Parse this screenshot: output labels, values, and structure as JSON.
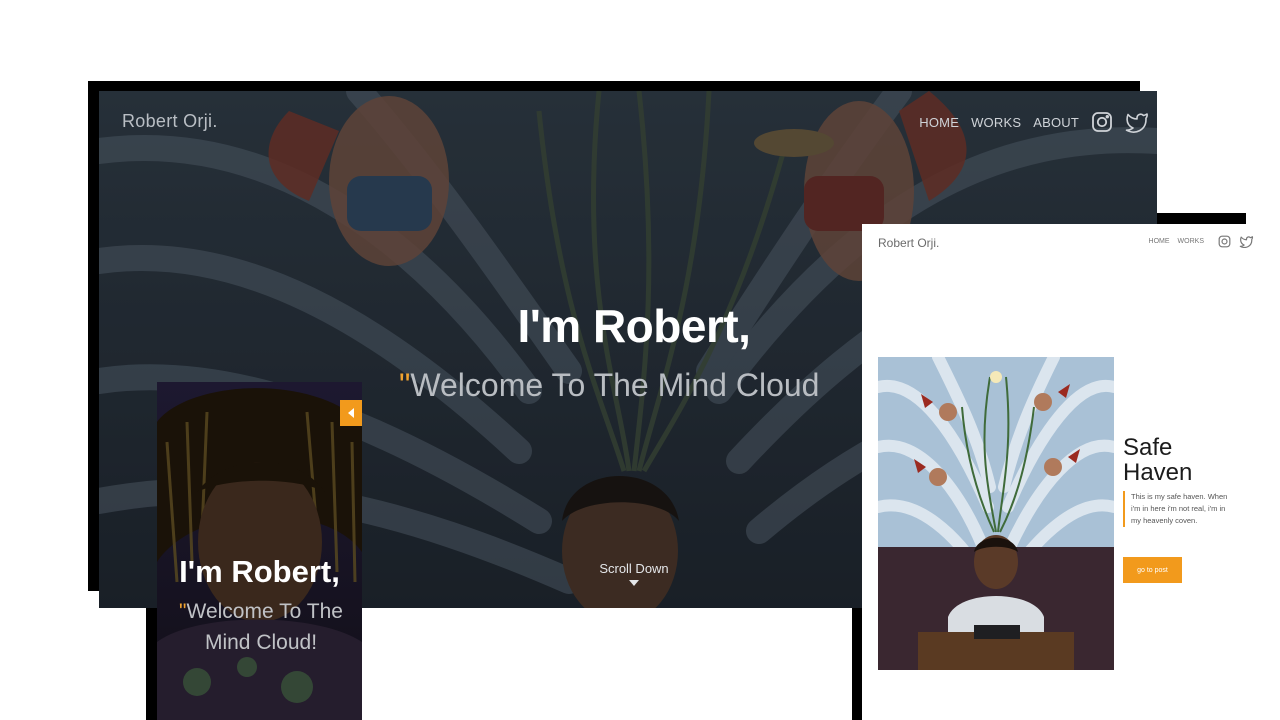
{
  "desktop": {
    "logo": "Robert Orji.",
    "nav": {
      "home": "HOME",
      "works": "WORKS",
      "about": "ABOUT"
    },
    "icons": [
      "instagram-icon",
      "twitter-icon"
    ],
    "hero_title": "I'm Robert,",
    "hero_subtitle": "Welcome To The Mind Cloud",
    "quote_mark": "\"",
    "scroll_label": "Scroll Down"
  },
  "mobile": {
    "hero_title": "I'm Robert,",
    "hero_subtitle": "Welcome To The Mind Cloud!",
    "quote_mark": "\"",
    "menu_icon": "caret-left-icon"
  },
  "tablet": {
    "logo": "Robert Orji.",
    "nav": {
      "home": "HOME",
      "works": "WORKS"
    },
    "icons": [
      "instagram-icon",
      "twitter-icon"
    ],
    "post_title": "Safe Haven",
    "post_body": "This is my safe haven. When i'm in here i'm not real, i'm in my heavenly coven.",
    "post_button": "go to post"
  },
  "colors": {
    "accent": "#f29a1c",
    "hero_text": "#ffffff",
    "dark_bg": "#1f2833"
  }
}
